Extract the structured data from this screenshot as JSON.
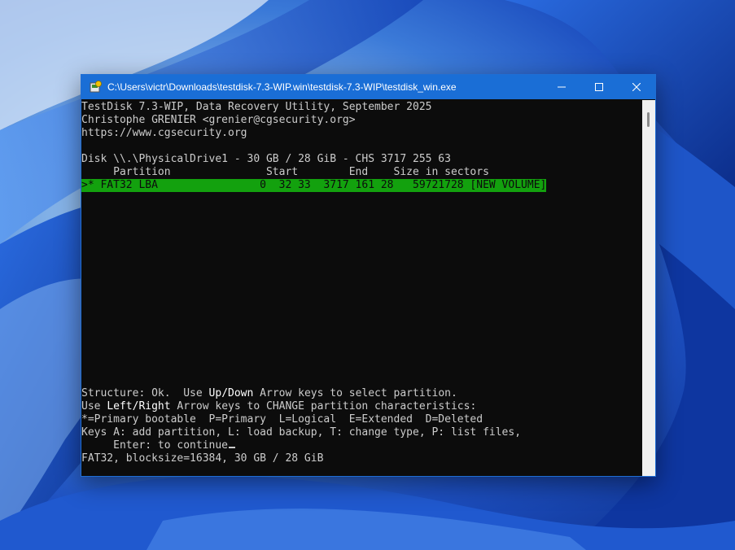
{
  "window": {
    "title": "C:\\Users\\victr\\Downloads\\testdisk-7.3-WIP.win\\testdisk-7.3-WIP\\testdisk_win.exe"
  },
  "console": {
    "header": [
      "TestDisk 7.3-WIP, Data Recovery Utility, September 2025",
      "Christophe GRENIER <grenier@cgsecurity.org>",
      "https://www.cgsecurity.org"
    ],
    "disk": "Disk \\\\.\\PhysicalDrive1 - 30 GB / 28 GiB - CHS 3717 255 63",
    "columns": "     Partition               Start        End    Size in sectors",
    "partition_row": ">* FAT32 LBA                0  32 33  3717 161 28   59721728 [NEW VOLUME]",
    "footer": {
      "l1_a": "Structure: Ok.  Use ",
      "l1_b": "Up/Down",
      "l1_c": " Arrow keys to select partition.",
      "l2_a": "Use ",
      "l2_b": "Left/Right",
      "l2_c": " Arrow keys to CHANGE partition characteristics:",
      "l3": "*=Primary bootable  P=Primary  L=Logical  E=Extended  D=Deleted",
      "l4": "Keys A: add partition, L: load backup, T: change type, P: list files,",
      "l5": "     Enter: to continue",
      "l6": "FAT32, blocksize=16384, 30 GB / 28 GiB"
    }
  },
  "colors": {
    "title_bar": "#1a6ed6",
    "console_bg": "#0c0c0c",
    "console_fg": "#cccccc",
    "selection_bg": "#13a10e"
  }
}
